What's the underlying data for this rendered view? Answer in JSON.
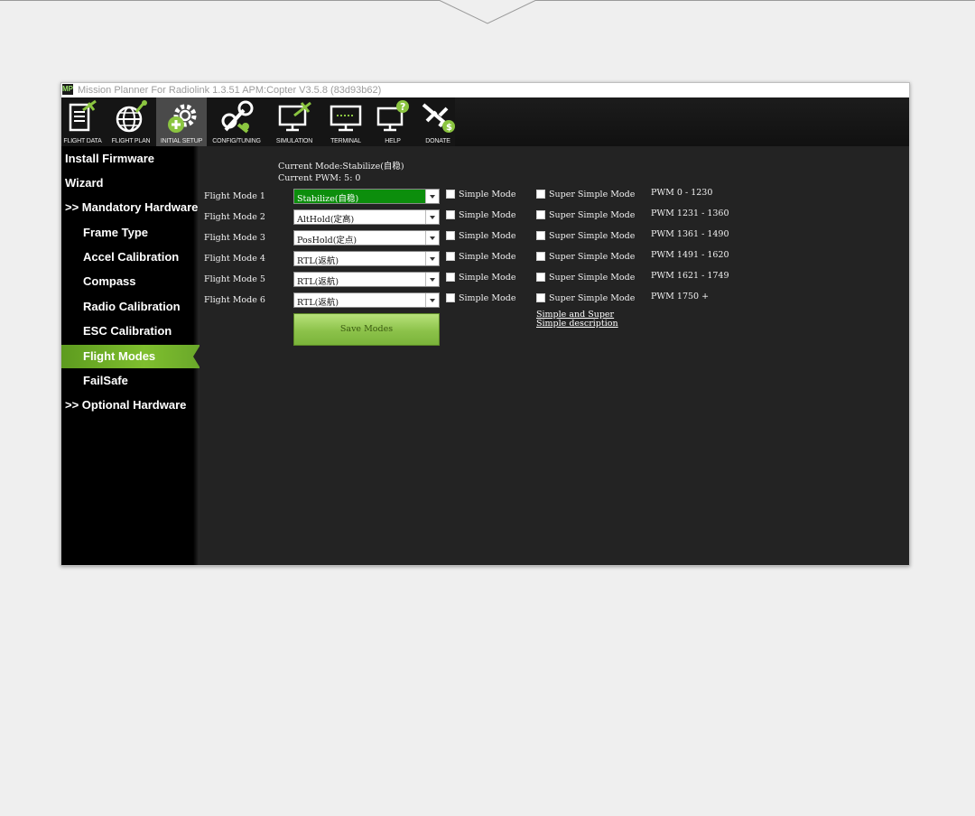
{
  "window": {
    "title": "Mission Planner For Radiolink 1.3.51 APM:Copter V3.5.8 (83d93b62)",
    "app_icon_text": "MP"
  },
  "toolbar": {
    "buttons": [
      {
        "label": "FLIGHT DATA",
        "icon": "flight-data-icon"
      },
      {
        "label": "FLIGHT PLAN",
        "icon": "flight-plan-icon"
      },
      {
        "label": "INITIAL SETUP",
        "icon": "initial-setup-icon"
      },
      {
        "label": "CONFIG/TUNING",
        "icon": "config-tuning-icon"
      },
      {
        "label": "SIMULATION",
        "icon": "simulation-icon"
      },
      {
        "label": "TERMINAL",
        "icon": "terminal-icon"
      },
      {
        "label": "HELP",
        "icon": "help-icon"
      },
      {
        "label": "DONATE",
        "icon": "donate-icon"
      }
    ],
    "active": "INITIAL SETUP"
  },
  "sidebar": {
    "items": [
      {
        "label": "Install Firmware"
      },
      {
        "label": "Wizard"
      },
      {
        "label": ">> Mandatory Hardware"
      },
      {
        "label": "Frame Type"
      },
      {
        "label": "Accel Calibration"
      },
      {
        "label": "Compass"
      },
      {
        "label": "Radio Calibration"
      },
      {
        "label": "ESC Calibration"
      },
      {
        "label": "Flight Modes"
      },
      {
        "label": "FailSafe"
      },
      {
        "label": ">> Optional Hardware"
      }
    ],
    "selected": "Flight Modes"
  },
  "main": {
    "current_mode_label": "Current Mode:",
    "current_mode_value": "Stabilize(自稳)",
    "current_pwm_label": "Current PWM:",
    "current_pwm_value": "5: 0",
    "simple_label": "Simple Mode",
    "super_simple_label": "Super Simple Mode",
    "modes": [
      {
        "label": "Flight Mode 1",
        "value": "Stabilize(自稳)",
        "pwm": "PWM 0 - 1230"
      },
      {
        "label": "Flight Mode 2",
        "value": "AltHold(定高)",
        "pwm": "PWM 1231 - 1360"
      },
      {
        "label": "Flight Mode 3",
        "value": "PosHold(定点)",
        "pwm": "PWM 1361 - 1490"
      },
      {
        "label": "Flight Mode 4",
        "value": "RTL(返航)",
        "pwm": "PWM 1491 - 1620"
      },
      {
        "label": "Flight Mode 5",
        "value": "RTL(返航)",
        "pwm": "PWM 1621 - 1749"
      },
      {
        "label": "Flight Mode 6",
        "value": "RTL(返航)",
        "pwm": "PWM 1750 +"
      }
    ],
    "save_label": "Save Modes",
    "description_line1": "Simple and Super",
    "description_line2": "Simple description"
  },
  "colors": {
    "accent_green": "#7fbf2e",
    "active_combo": "#0c8e0c",
    "panel_bg": "#232323"
  }
}
